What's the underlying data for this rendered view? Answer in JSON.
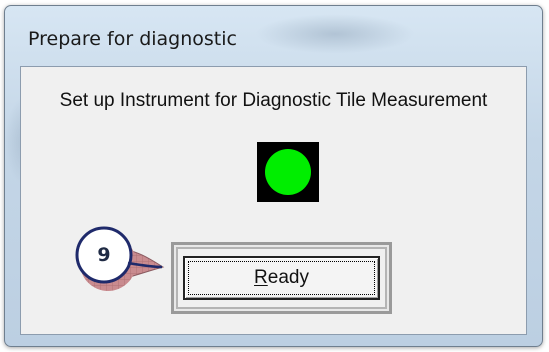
{
  "window": {
    "title": "Prepare for diagnostic"
  },
  "dialog": {
    "message": "Set up Instrument for Diagnostic Tile Measurement",
    "indicator": {
      "state": "ready",
      "color": "#00ee00"
    },
    "ready_button": {
      "accelerator": "R",
      "label_rest": "eady"
    }
  },
  "callout": {
    "step_number": "9",
    "fill_color": "#c98b8f",
    "border_color": "#1f2a6b"
  }
}
